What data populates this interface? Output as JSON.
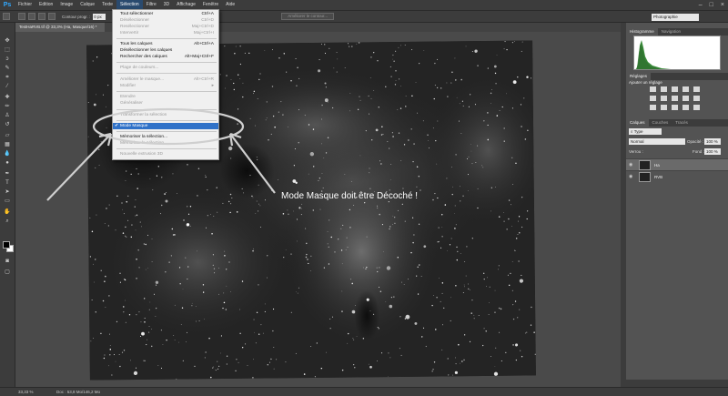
{
  "menubar": {
    "logo": "Ps",
    "items": [
      "Fichier",
      "Edition",
      "Image",
      "Calque",
      "Texte",
      "Sélection",
      "Filtre",
      "3D",
      "Affichage",
      "Fenêtre",
      "Aide"
    ],
    "active_index": 5,
    "window_controls": [
      "–",
      "□",
      "×"
    ]
  },
  "options": {
    "contour_label": "Contour progr. :",
    "contour_value": "0 px",
    "refine_button": "Améliorer le contour...",
    "workspace": "Photographie"
  },
  "document": {
    "tab_title": "TestHaRVB.tif @ 33,3% (Ha, Masque/16) *",
    "zoom": "33,33 %",
    "doc_info": "Doc : 53,8 Mo/146,2 Mo"
  },
  "selection_menu": {
    "items": [
      {
        "label": "Tout sélectionner",
        "shortcut": "Ctrl+A",
        "disabled": false
      },
      {
        "label": "Désélectionner",
        "shortcut": "Ctrl+D",
        "disabled": true
      },
      {
        "label": "Resélectionner",
        "shortcut": "Maj+Ctrl+D",
        "disabled": true
      },
      {
        "label": "Intervertir",
        "shortcut": "Maj+Ctrl+I",
        "disabled": true
      },
      {
        "label": "Tous les calques",
        "shortcut": "Alt+Ctrl+A",
        "disabled": false
      },
      {
        "label": "Désélectionner les calques",
        "shortcut": "",
        "disabled": false
      },
      {
        "label": "Rechercher des calques",
        "shortcut": "Alt+Maj+Ctrl+F",
        "disabled": false
      },
      {
        "label": "Plage de couleurs...",
        "shortcut": "",
        "disabled": true
      },
      {
        "label": "Améliorer le masque...",
        "shortcut": "Alt+Ctrl+R",
        "disabled": true
      },
      {
        "label": "Modifier",
        "shortcut": "▸",
        "disabled": true
      },
      {
        "label": "Etendre",
        "shortcut": "",
        "disabled": true
      },
      {
        "label": "Généraliser",
        "shortcut": "",
        "disabled": true
      },
      {
        "label": "Transformer la sélection",
        "shortcut": "",
        "disabled": true
      },
      {
        "label": "Mode Masque",
        "shortcut": "",
        "disabled": false,
        "checked": true
      },
      {
        "label": "Mémoriser la sélection...",
        "shortcut": "",
        "disabled": false
      },
      {
        "label": "Mémoriser la sélection...",
        "shortcut": "",
        "disabled": true
      },
      {
        "label": "Nouvelle extrusion 3D",
        "shortcut": "",
        "disabled": true
      }
    ],
    "check_mark": "✔"
  },
  "annotation": {
    "text": "Mode Masque doit être Décoché !"
  },
  "panels": {
    "histogram_tabs": [
      "Histogramme",
      "Navigation"
    ],
    "adjust_tabs": [
      "Réglages"
    ],
    "adjust_title": "Ajouter un réglage",
    "layers_tabs": [
      "Calques",
      "Couches",
      "Tracés"
    ],
    "filter_type": "Type",
    "blend_mode": "Normal",
    "opacity_label": "Opacité :",
    "opacity_value": "100 %",
    "lock_label": "Verrou :",
    "fill_label": "Fond :",
    "fill_value": "100 %",
    "layers": [
      {
        "name": "Ha",
        "selected": true
      },
      {
        "name": "RVB",
        "selected": false
      }
    ]
  },
  "colors": {
    "accent": "#3072c8",
    "menubar": "#3c3c3c",
    "workspace": "#535353"
  },
  "icons": {
    "eye": "eye-icon"
  }
}
